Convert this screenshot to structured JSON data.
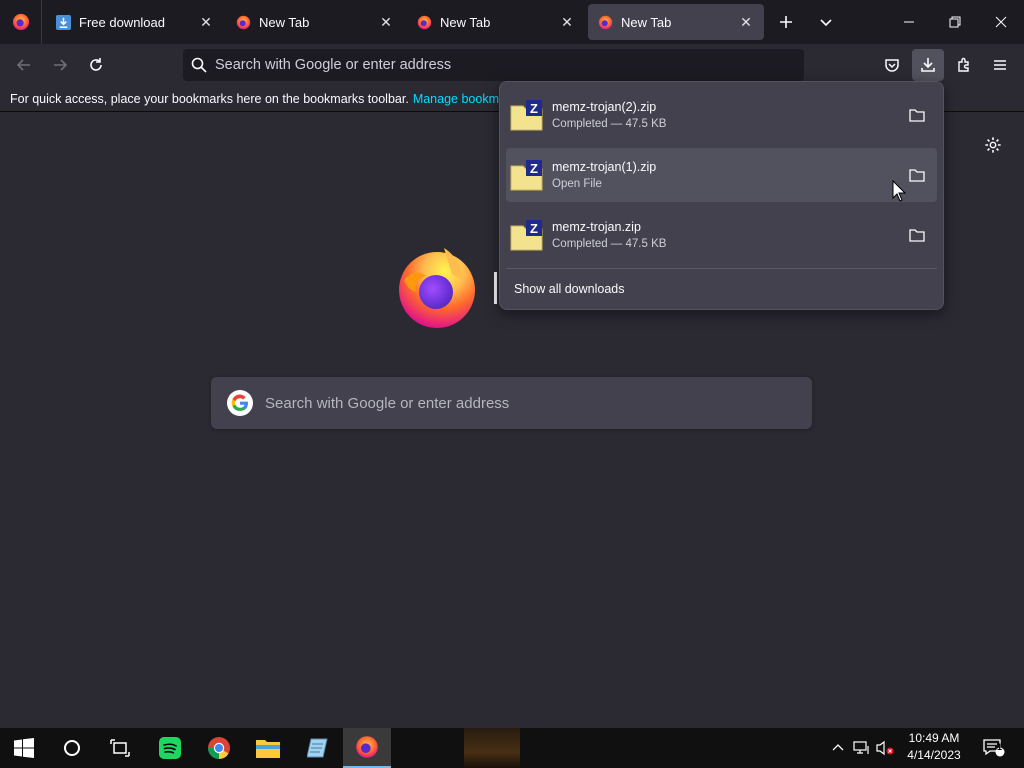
{
  "tabs": [
    {
      "title": "Free download",
      "active": false
    },
    {
      "title": "New Tab",
      "active": false
    },
    {
      "title": "New Tab",
      "active": false
    },
    {
      "title": "New Tab",
      "active": true
    }
  ],
  "navbar": {
    "url_placeholder": "Search with Google or enter address"
  },
  "bookmarks_bar": {
    "message": "For quick access, place your bookmarks here on the bookmarks toolbar.",
    "manage_link": "Manage bookmarks…"
  },
  "newtab": {
    "search_placeholder": "Search with Google or enter address"
  },
  "downloads_panel": {
    "items": [
      {
        "name": "memz-trojan(2).zip",
        "status": "Completed — 47.5 KB",
        "hovered": false
      },
      {
        "name": "memz-trojan(1).zip",
        "status": "Open File",
        "hovered": true
      },
      {
        "name": "memz-trojan.zip",
        "status": "Completed — 47.5 KB",
        "hovered": false
      }
    ],
    "show_all_label": "Show all downloads"
  },
  "taskbar": {
    "time": "10:49 AM",
    "date": "4/14/2023",
    "notification_count": "1",
    "pinned": [
      "windows-start",
      "cortana",
      "task-view",
      "spotify",
      "chrome",
      "file-explorer",
      "notepad",
      "firefox"
    ]
  },
  "colors": {
    "accent_link": "#00ddff",
    "panel_bg": "#42414d",
    "toolbar_bg": "#2b2a33",
    "tabstrip_bg": "#1c1b22"
  }
}
